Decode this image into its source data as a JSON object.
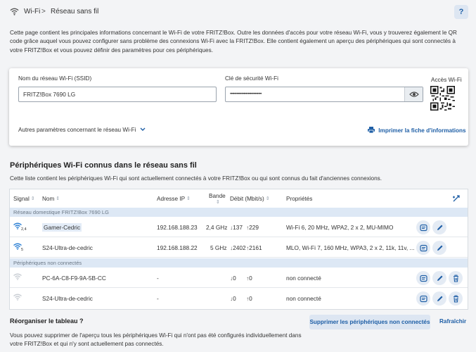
{
  "breadcrumb": {
    "item1": "Wi-Fi",
    "separator": ">",
    "item2": "Réseau sans fil"
  },
  "help_label": "?",
  "intro_text": "Cette page contient les principales informations concernant le Wi-Fi de votre FRITZ!Box. Outre les données d'accès pour votre réseau Wi-Fi, vous y trouverez également le QR code grâce auquel vous pouvez configurer sans problème des connexions Wi-Fi avec la FRITZ!Box. Elle contient également un aperçu des périphériques qui sont connectés à votre FRITZ!Box et vous pouvez définir des paramètres pour ces périphériques.",
  "network_card": {
    "ssid_label": "Nom du réseau Wi-Fi (SSID)",
    "ssid_value": "FRITZ!Box 7690 LG",
    "key_label": "Clé de sécurité Wi-Fi",
    "key_value": "••••••••••••••••••••••••••••",
    "qr_label": "Accès Wi-Fi",
    "more_settings": "Autres paramètres concernant le réseau Wi-Fi",
    "print_link": "Imprimer la fiche d'informations"
  },
  "devices": {
    "title": "Périphériques Wi-Fi connus dans le réseau sans fil",
    "subtitle": "Cette liste contient les périphériques Wi-Fi qui sont actuellement connectés à votre FRITZ!Box ou qui sont connus du fait d'anciennes connexions.",
    "headers": {
      "signal": "Signal",
      "name": "Nom",
      "ip": "Adresse IP",
      "band": "Bande",
      "rate": "Débit (Mbit/s)",
      "props": "Propriétés"
    },
    "group1": "Réseau domestique FRITZ!Box 7690 LG",
    "group2": "Périphériques non connectés",
    "rows": [
      {
        "signal_sub": "2,4",
        "name": "Gamer-Cedric",
        "ip": "192.168.188.23",
        "band": "2,4 GHz",
        "down": "137",
        "up": "229",
        "props": "Wi-Fi 6, 20 MHz, WPA2, 2 x 2, MU-MIMO"
      },
      {
        "signal_sub": "5",
        "name": "S24-Ultra-de-cedric",
        "ip": "192.168.188.22",
        "band": "5 GHz",
        "down": "2402",
        "up": "2161",
        "props": "MLO, Wi-Fi 7, 160 MHz, WPA3, 2 x 2, 11k, 11v, ..."
      },
      {
        "signal_sub": "",
        "name": "PC-6A-C8-F9-9A-5B-CC",
        "ip": "-",
        "band": "",
        "down": "0",
        "up": "0",
        "props": "non connecté"
      },
      {
        "signal_sub": "",
        "name": "S24-Ultra-de-cedric",
        "ip": "-",
        "band": "",
        "down": "0",
        "up": "0",
        "props": "non connecté"
      }
    ]
  },
  "reorg": {
    "title": "Réorganiser le tableau ?",
    "text": "Vous pouvez supprimer de l'aperçu tous les périphériques Wi-Fi qui n'ont pas été configurés individuellement dans votre FRITZ!Box et qui n'y sont actuellement pas connectés.",
    "delete_button": "Supprimer les périphériques non connectés",
    "refresh_button": "Rafraîchir"
  },
  "colors": {
    "accent": "#1f5fa6",
    "group_bg": "#dde8f5",
    "background": "#f3f4f6"
  }
}
